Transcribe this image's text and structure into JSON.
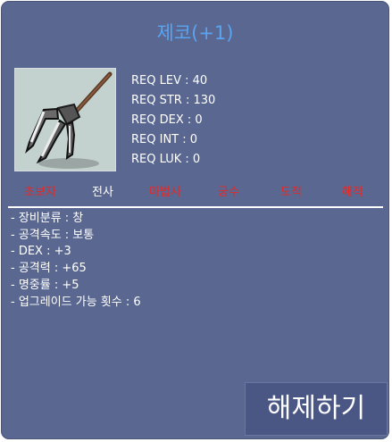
{
  "item": {
    "name": "제코(+1)",
    "icon": "trident-spear-icon"
  },
  "requirements": [
    {
      "label": "REQ LEV",
      "value": "40"
    },
    {
      "label": "REQ STR",
      "value": "130"
    },
    {
      "label": "REQ DEX",
      "value": "0"
    },
    {
      "label": "REQ INT",
      "value": "0"
    },
    {
      "label": "REQ LUK",
      "value": "0"
    }
  ],
  "jobs": [
    {
      "name": "초보자",
      "eligible": false
    },
    {
      "name": "전사",
      "eligible": true
    },
    {
      "name": "마법사",
      "eligible": false
    },
    {
      "name": "궁수",
      "eligible": false
    },
    {
      "name": "도적",
      "eligible": false
    },
    {
      "name": "해적",
      "eligible": false
    }
  ],
  "stats": [
    "- 장비분류 : 창",
    "- 공격속도 : 보통",
    "- DEX : +3",
    "- 공격력 : +65",
    "- 명중률 : +5",
    "- 업그레이드 가능 횟수 : 6"
  ],
  "actions": {
    "release_label": "해제하기"
  },
  "colors": {
    "panel": "#5a6891",
    "item_name": "#5aa3f0",
    "job_unavailable": "#e02a2a",
    "job_available": "#ffffff"
  }
}
